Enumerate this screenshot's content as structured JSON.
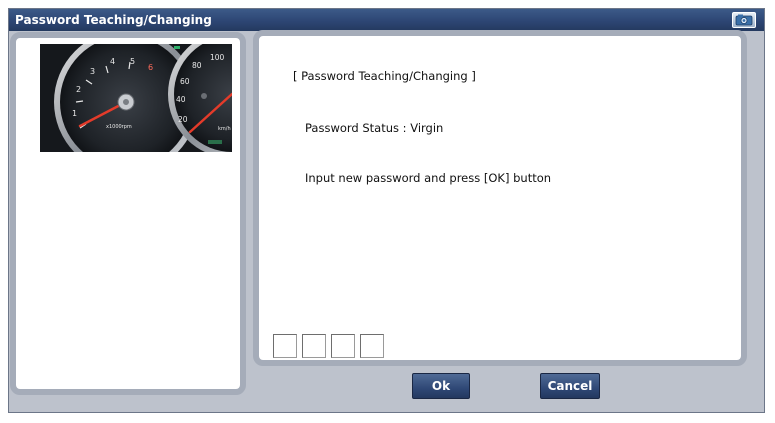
{
  "window": {
    "title": "Password Teaching/Changing",
    "title_icon": "camera-icon"
  },
  "gauge_image": {
    "tach_ticks": [
      "1",
      "2",
      "3",
      "4",
      "5",
      "6"
    ],
    "tach_unit": "x1000rpm",
    "speed_ticks": [
      "20",
      "40",
      "60",
      "80",
      "100"
    ],
    "speed_unit": "km/h"
  },
  "content": {
    "heading": "[ Password Teaching/Changing ]",
    "status": "Password Status : Virgin",
    "instruction": "Input new password and press [OK] button",
    "password_digits": [
      "",
      "",
      "",
      ""
    ]
  },
  "buttons": {
    "ok_label": "Ok",
    "cancel_label": "Cancel"
  },
  "colors": {
    "title_bar": "#2d4674",
    "panel_border": "#a5acb9",
    "button": "#2f4876"
  }
}
